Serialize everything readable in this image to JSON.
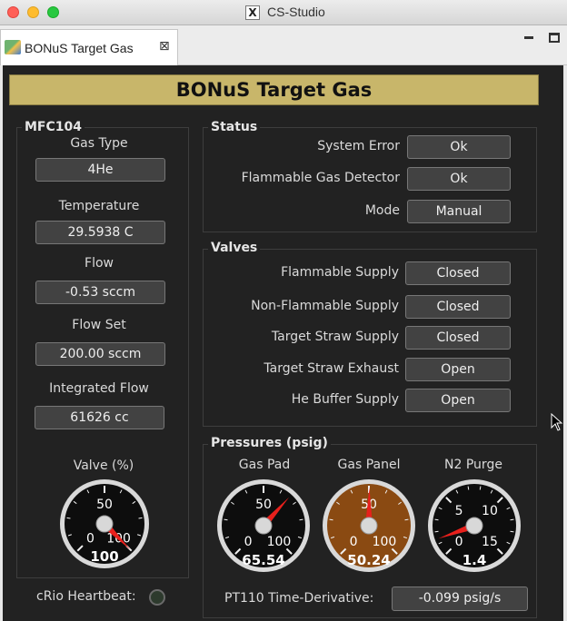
{
  "window": {
    "title": "CS-Studio",
    "app_icon": "X"
  },
  "tab": {
    "label": "BONuS Target Gas",
    "close": "⊠"
  },
  "banner": "BONuS Target Gas",
  "mfc": {
    "title": "MFC104",
    "gas_type_label": "Gas Type",
    "gas_type": "4He",
    "temperature_label": "Temperature",
    "temperature": "29.5938 C",
    "flow_label": "Flow",
    "flow": "-0.53 sccm",
    "flow_set_label": "Flow Set",
    "flow_set": "200.00 sccm",
    "integrated_flow_label": "Integrated Flow",
    "integrated_flow": "61626 cc",
    "valve_label": "Valve (%)"
  },
  "heartbeat_label": "cRio Heartbeat:",
  "status": {
    "title": "Status",
    "rows": [
      {
        "label": "System Error",
        "value": "Ok"
      },
      {
        "label": "Flammable Gas Detector",
        "value": "Ok"
      },
      {
        "label": "Mode",
        "value": "Manual"
      }
    ]
  },
  "valves": {
    "title": "Valves",
    "rows": [
      {
        "label": "Flammable Supply",
        "value": "Closed"
      },
      {
        "label": "Non-Flammable Supply",
        "value": "Closed"
      },
      {
        "label": "Target Straw Supply",
        "value": "Closed"
      },
      {
        "label": "Target Straw Exhaust",
        "value": "Open"
      },
      {
        "label": "He Buffer Supply",
        "value": "Open"
      }
    ]
  },
  "pressures": {
    "title": "Pressures (psig)",
    "derivative_label": "PT110 Time-Derivative:",
    "derivative_value": "-0.099 psig/s"
  },
  "gauges": [
    {
      "id": "valve",
      "min": 0,
      "max": 100,
      "ticks": [
        "0",
        "50",
        "100"
      ],
      "value": 100,
      "value_text": "100",
      "face": "#0d0d0d"
    },
    {
      "id": "gas-pad",
      "label": "Gas Pad",
      "min": 0,
      "max": 100,
      "ticks": [
        "0",
        "50",
        "100"
      ],
      "value": 65.54,
      "value_text": "65.54",
      "face": "#0d0d0d"
    },
    {
      "id": "gas-panel",
      "label": "Gas Panel",
      "min": 0,
      "max": 100,
      "ticks": [
        "0",
        "50",
        "100"
      ],
      "value": 50.24,
      "value_text": "50.24",
      "face": "#8a4a12"
    },
    {
      "id": "n2-purge",
      "label": "N2 Purge",
      "min": 0,
      "max": 15,
      "ticks": [
        "0",
        "5",
        "10",
        "15"
      ],
      "value": 1.4,
      "value_text": "1.4",
      "face": "#0d0d0d"
    }
  ],
  "colors": {
    "panel": "#222222",
    "banner": "#c8b66a",
    "needle": "#e8201c"
  }
}
